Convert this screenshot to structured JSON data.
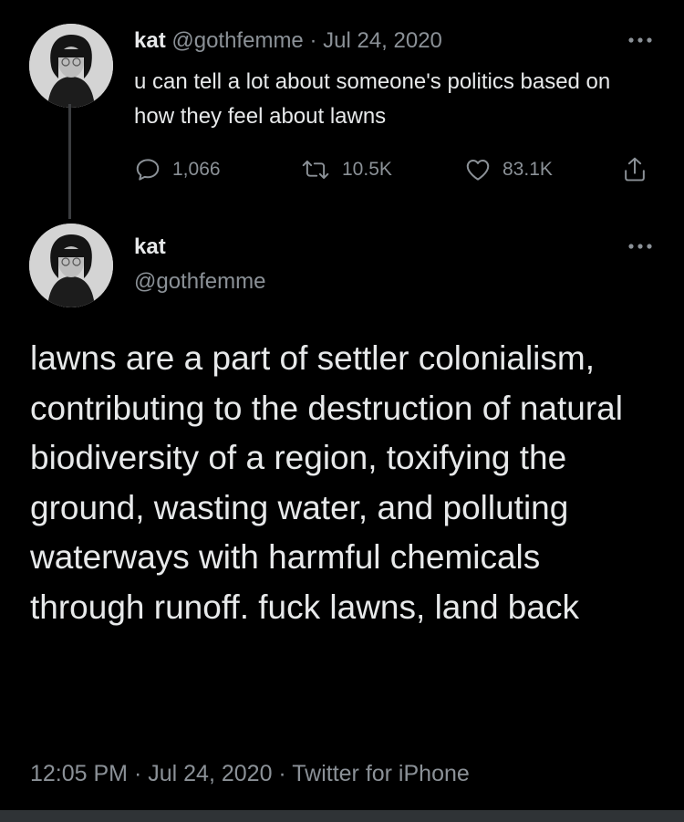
{
  "reply_tweet": {
    "display_name": "kat",
    "handle": "@gothfemme",
    "separator": "·",
    "date": "Jul 24, 2020",
    "text": "u can tell a lot about someone's politics based on how they feel about lawns",
    "more_icon": "more-horizontal-icon",
    "actions": {
      "replies": "1,066",
      "retweets": "10.5K",
      "likes": "83.1K",
      "reply_icon": "comment-icon",
      "retweet_icon": "retweet-icon",
      "like_icon": "heart-icon",
      "share_icon": "share-icon"
    }
  },
  "main_tweet": {
    "display_name": "kat",
    "handle": "@gothfemme",
    "more_icon": "more-horizontal-icon",
    "text": "lawns are a part of settler colonialism, contributing to the destruction of natural biodiversity of a region, toxifying the ground, wasting water, and polluting waterways with harmful chemicals through runoff. fuck lawns, land back",
    "time": "12:05 PM",
    "date": "Jul 24, 2020",
    "source": "Twitter for iPhone",
    "separator": "·"
  },
  "colors": {
    "background": "#000000",
    "text": "#e7e9ea",
    "muted": "#8b9197",
    "thread_line": "#3b3d40"
  }
}
